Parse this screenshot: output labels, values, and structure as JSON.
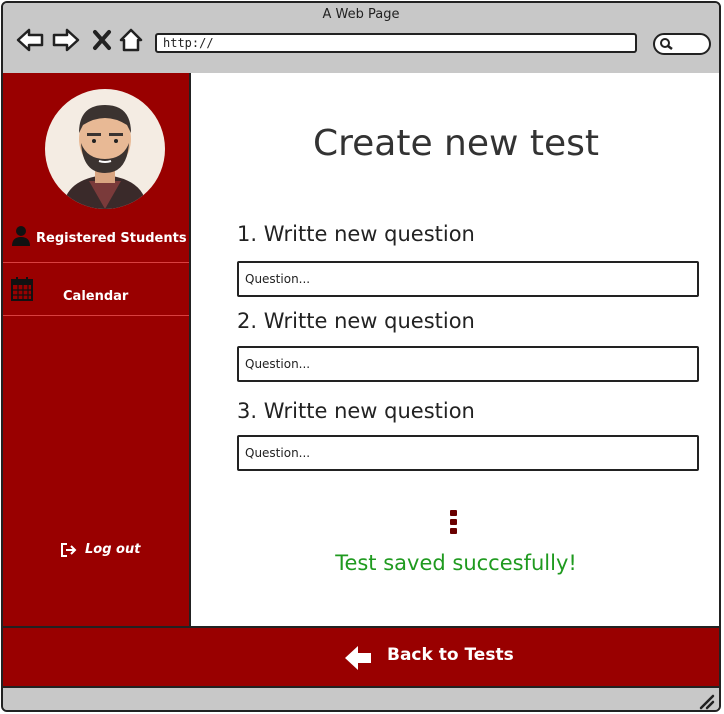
{
  "window": {
    "title": "A Web Page"
  },
  "browser": {
    "url": "http://"
  },
  "sidebar": {
    "items": [
      {
        "label": "Registered Students",
        "icon": "user-icon"
      },
      {
        "label": "Calendar",
        "icon": "calendar-icon"
      }
    ],
    "logout": {
      "label": "Log out",
      "icon": "logout-icon"
    }
  },
  "main": {
    "title": "Create new test",
    "questions": [
      {
        "label": "1. Writte new question",
        "placeholder": "Question..."
      },
      {
        "label": "2. Writte new question",
        "placeholder": "Question..."
      },
      {
        "label": "3. Writte new question",
        "placeholder": "Question..."
      }
    ],
    "more_icon": "vertical-ellipsis-icon",
    "status": "Test saved succesfully!"
  },
  "footer": {
    "back_label": "Back to Tests",
    "icon": "arrow-left-icon"
  },
  "colors": {
    "sidebar_bg": "#990000",
    "success": "#1f9a1f",
    "chrome": "#c8c8c8"
  }
}
